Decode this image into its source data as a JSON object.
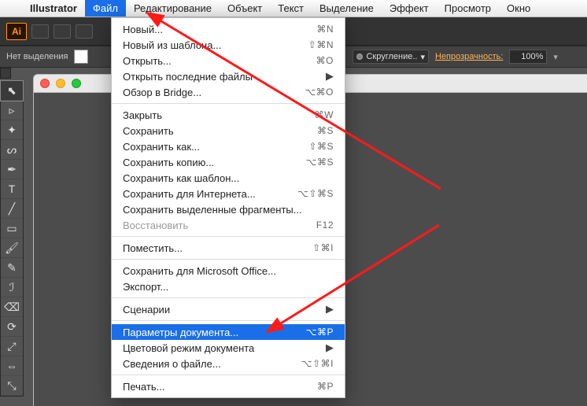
{
  "macbar": {
    "app": "Illustrator",
    "items": [
      "Файл",
      "Редактирование",
      "Объект",
      "Текст",
      "Выделение",
      "Эффект",
      "Просмотр",
      "Окно"
    ],
    "active_index": 0
  },
  "ai_logo": "Ai",
  "ctrl": {
    "no_selection": "Нет выделения",
    "cap_style": "Скругление..",
    "opacity_label": "Непрозрачность:",
    "opacity_value": "100%"
  },
  "tools": [
    {
      "name": "selection-tool",
      "glyph": "⬉",
      "sel": true
    },
    {
      "name": "direct-selection-tool",
      "glyph": "▹",
      "sel": false
    },
    {
      "name": "magic-wand-tool",
      "glyph": "✦",
      "sel": false
    },
    {
      "name": "lasso-tool",
      "glyph": "ᔕ",
      "sel": false
    },
    {
      "name": "pen-tool",
      "glyph": "✒",
      "sel": false
    },
    {
      "name": "type-tool",
      "glyph": "T",
      "sel": false
    },
    {
      "name": "line-tool",
      "glyph": "╱",
      "sel": false
    },
    {
      "name": "rectangle-tool",
      "glyph": "▭",
      "sel": false
    },
    {
      "name": "paintbrush-tool",
      "glyph": "🖌",
      "sel": false
    },
    {
      "name": "pencil-tool",
      "glyph": "✎",
      "sel": false
    },
    {
      "name": "blob-brush-tool",
      "glyph": "ℐ",
      "sel": false
    },
    {
      "name": "eraser-tool",
      "glyph": "⌫",
      "sel": false
    },
    {
      "name": "rotate-tool",
      "glyph": "⟳",
      "sel": false
    },
    {
      "name": "scale-tool",
      "glyph": "⤢",
      "sel": false
    },
    {
      "name": "width-tool",
      "glyph": "⇔",
      "sel": false
    },
    {
      "name": "free-transform-tool",
      "glyph": "⤡",
      "sel": false
    }
  ],
  "menu": {
    "groups": [
      [
        {
          "label": "Новый...",
          "shortcut": "⌘N"
        },
        {
          "label": "Новый из шаблона...",
          "shortcut": "⇧⌘N"
        },
        {
          "label": "Открыть...",
          "shortcut": "⌘O"
        },
        {
          "label": "Открыть последние файлы",
          "submenu": true
        },
        {
          "label": "Обзор в Bridge...",
          "shortcut": "⌥⌘O"
        }
      ],
      [
        {
          "label": "Закрыть",
          "shortcut": "⌘W"
        },
        {
          "label": "Сохранить",
          "shortcut": "⌘S"
        },
        {
          "label": "Сохранить как...",
          "shortcut": "⇧⌘S"
        },
        {
          "label": "Сохранить копию...",
          "shortcut": "⌥⌘S"
        },
        {
          "label": "Сохранить как шаблон..."
        },
        {
          "label": "Сохранить для Интернета...",
          "shortcut": "⌥⇧⌘S"
        },
        {
          "label": "Сохранить выделенные фрагменты..."
        },
        {
          "label": "Восстановить",
          "shortcut": "F12",
          "disabled": true
        }
      ],
      [
        {
          "label": "Поместить...",
          "shortcut": "⇧⌘I"
        }
      ],
      [
        {
          "label": "Сохранить для Microsoft Office..."
        },
        {
          "label": "Экспорт..."
        }
      ],
      [
        {
          "label": "Сценарии",
          "submenu": true
        }
      ],
      [
        {
          "label": "Параметры документа...",
          "shortcut": "⌥⌘P",
          "highlight": true
        },
        {
          "label": "Цветовой режим документа",
          "submenu": true
        },
        {
          "label": "Сведения о файле...",
          "shortcut": "⌥⇧⌘I"
        }
      ],
      [
        {
          "label": "Печать...",
          "shortcut": "⌘P"
        }
      ]
    ]
  }
}
